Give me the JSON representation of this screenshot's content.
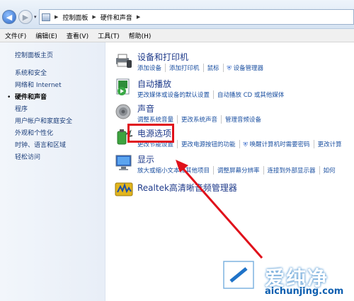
{
  "address_bar": {
    "crumbs": [
      "控制面板",
      "硬件和声音"
    ]
  },
  "menu": [
    "文件(F)",
    "编辑(E)",
    "查看(V)",
    "工具(T)",
    "帮助(H)"
  ],
  "sidebar": {
    "items": [
      {
        "label": "控制面板主页"
      },
      {
        "label": "系统和安全"
      },
      {
        "label": "网络和 Internet"
      },
      {
        "label": "硬件和声音"
      },
      {
        "label": "程序"
      },
      {
        "label": "用户帐户和家庭安全"
      },
      {
        "label": "外观和个性化"
      },
      {
        "label": "时钟、语言和区域"
      },
      {
        "label": "轻松访问"
      }
    ],
    "active_index": 3
  },
  "categories": [
    {
      "title": "设备和打印机",
      "icon": "printer-icon",
      "links": [
        "添加设备",
        "添加打印机",
        "鼠标",
        "设备管理器"
      ]
    },
    {
      "title": "自动播放",
      "icon": "autoplay-icon",
      "links": [
        "更改媒体或设备的默认设置",
        "自动播放 CD 或其他媒体"
      ]
    },
    {
      "title": "声音",
      "icon": "speaker-icon",
      "links": [
        "调整系统音量",
        "更改系统声音",
        "管理音频设备"
      ]
    },
    {
      "title": "电源选项",
      "icon": "power-icon",
      "links": [
        "更改节能设置",
        "更改电源按钮的功能",
        "唤醒计算机时需要密码",
        "更改计算"
      ]
    },
    {
      "title": "显示",
      "icon": "display-icon",
      "links": [
        "放大或缩小文本和其他项目",
        "调整屏幕分辨率",
        "连接到外部显示器",
        "如何"
      ]
    },
    {
      "title": "Realtek高清晰音频管理器",
      "icon": "realtek-icon",
      "links": []
    }
  ],
  "watermark": {
    "text": "爱纯净",
    "url": "aichunjing.com"
  },
  "colors": {
    "highlight": "#e0111b",
    "link": "#1a4fa0",
    "title": "#1e3a8a"
  }
}
